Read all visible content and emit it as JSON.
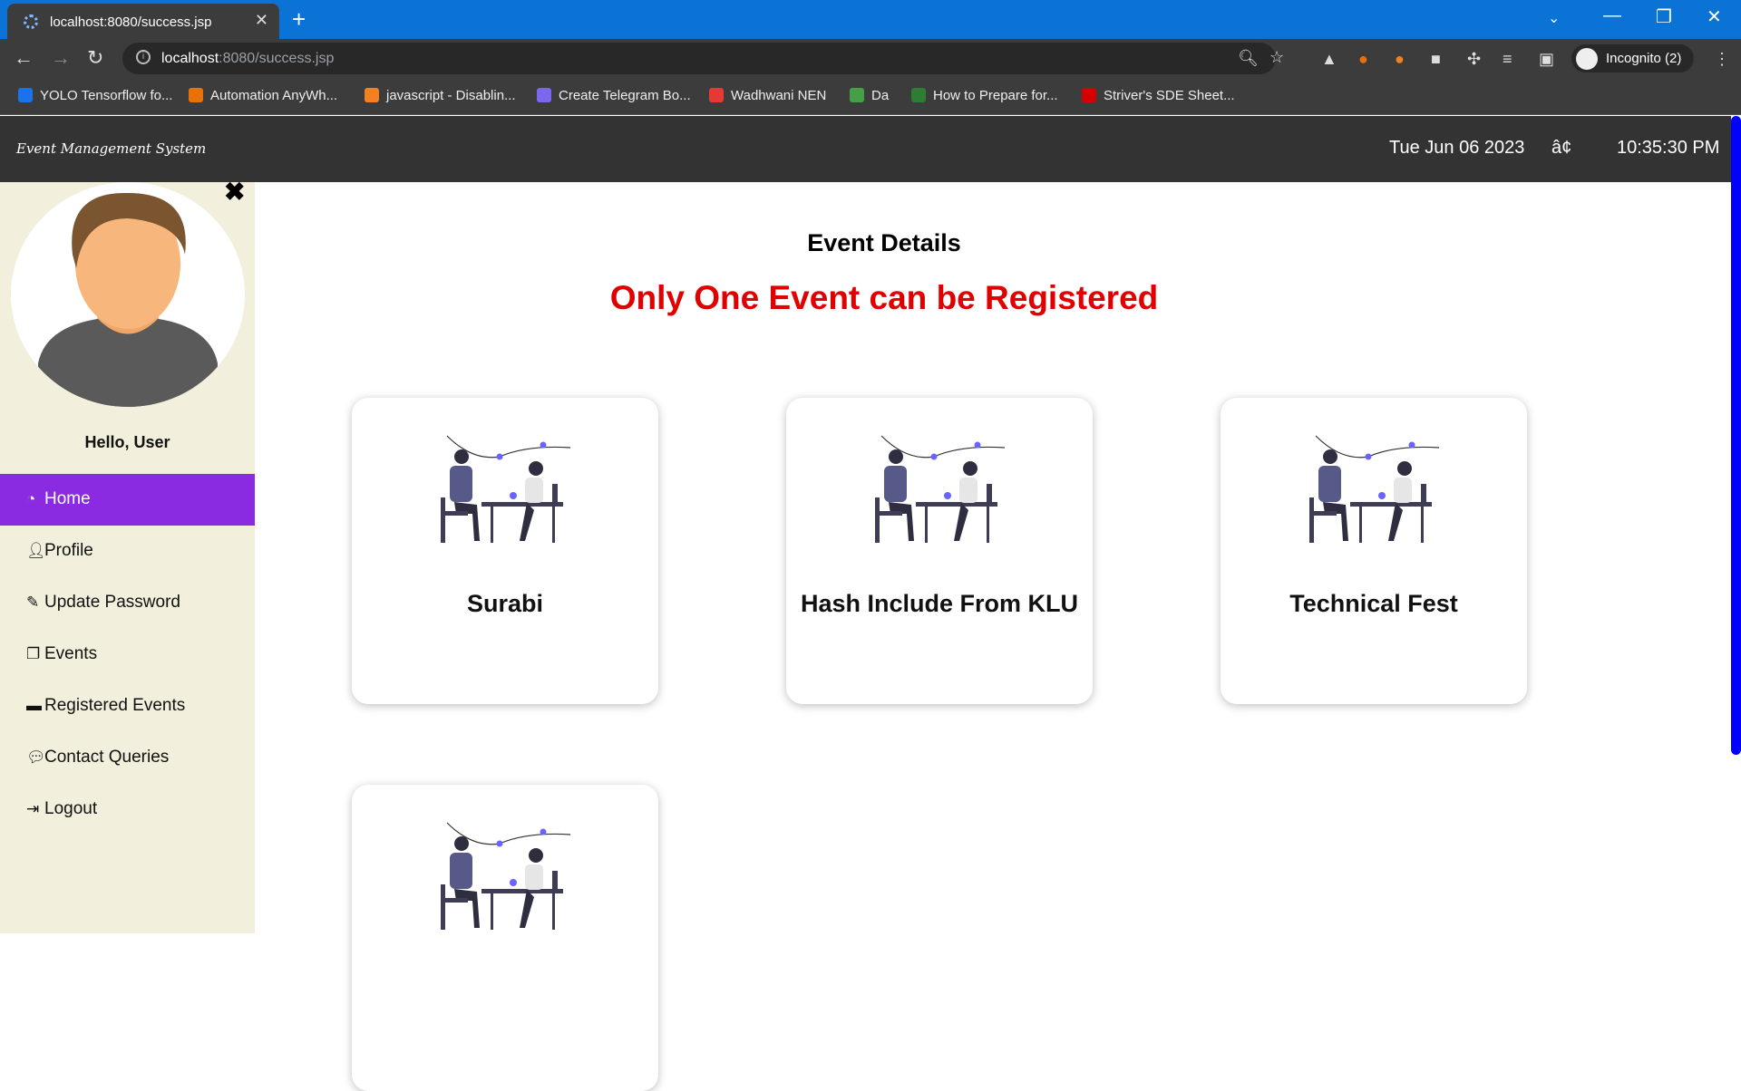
{
  "browser": {
    "tab_title": "localhost:8080/success.jsp",
    "url_host": "localhost",
    "url_path": ":8080/success.jsp",
    "profile_label": "Incognito (2)",
    "bookmarks": [
      {
        "label": "YOLO Tensorflow fo...",
        "color": "#1a73e8"
      },
      {
        "label": "Automation AnyWh...",
        "color": "#e8710a"
      },
      {
        "label": "javascript - Disablin...",
        "color": "#f48024"
      },
      {
        "label": "Create Telegram Bo...",
        "color": "#7b68ee"
      },
      {
        "label": "Wadhwani NEN",
        "color": "#e53935"
      },
      {
        "label": "Da",
        "color": "#43a047"
      },
      {
        "label": "How to Prepare for...",
        "color": "#2e7d32"
      },
      {
        "label": "Striver's SDE Sheet...",
        "color": "#d50000"
      }
    ]
  },
  "header": {
    "brand": "Event Management System",
    "date": "Tue Jun 06 2023",
    "separator": "â¢",
    "time": "10:35:30 PM"
  },
  "sidebar": {
    "greeting": "Hello, User",
    "items": [
      {
        "label": "Home",
        "icon": "dashboard-icon"
      },
      {
        "label": "Profile",
        "icon": "user-icon"
      },
      {
        "label": "Update Password",
        "icon": "edit-icon"
      },
      {
        "label": "Events",
        "icon": "copy-icon"
      },
      {
        "label": "Registered Events",
        "icon": "credit-card-icon"
      },
      {
        "label": "Contact Queries",
        "icon": "comments-icon"
      },
      {
        "label": "Logout",
        "icon": "sign-out-icon"
      }
    ]
  },
  "main": {
    "title": "Event Details",
    "warning": "Only One Event can be Registered",
    "warning_color": "#e00000",
    "events": [
      {
        "name": "Surabi"
      },
      {
        "name": "Hash Include From KLU"
      },
      {
        "name": "Technical Fest"
      },
      {
        "name": ""
      }
    ]
  },
  "colors": {
    "accent": "#8a2be2",
    "header_bg": "#333333",
    "sidebar_bg": "#f2f0dc"
  }
}
